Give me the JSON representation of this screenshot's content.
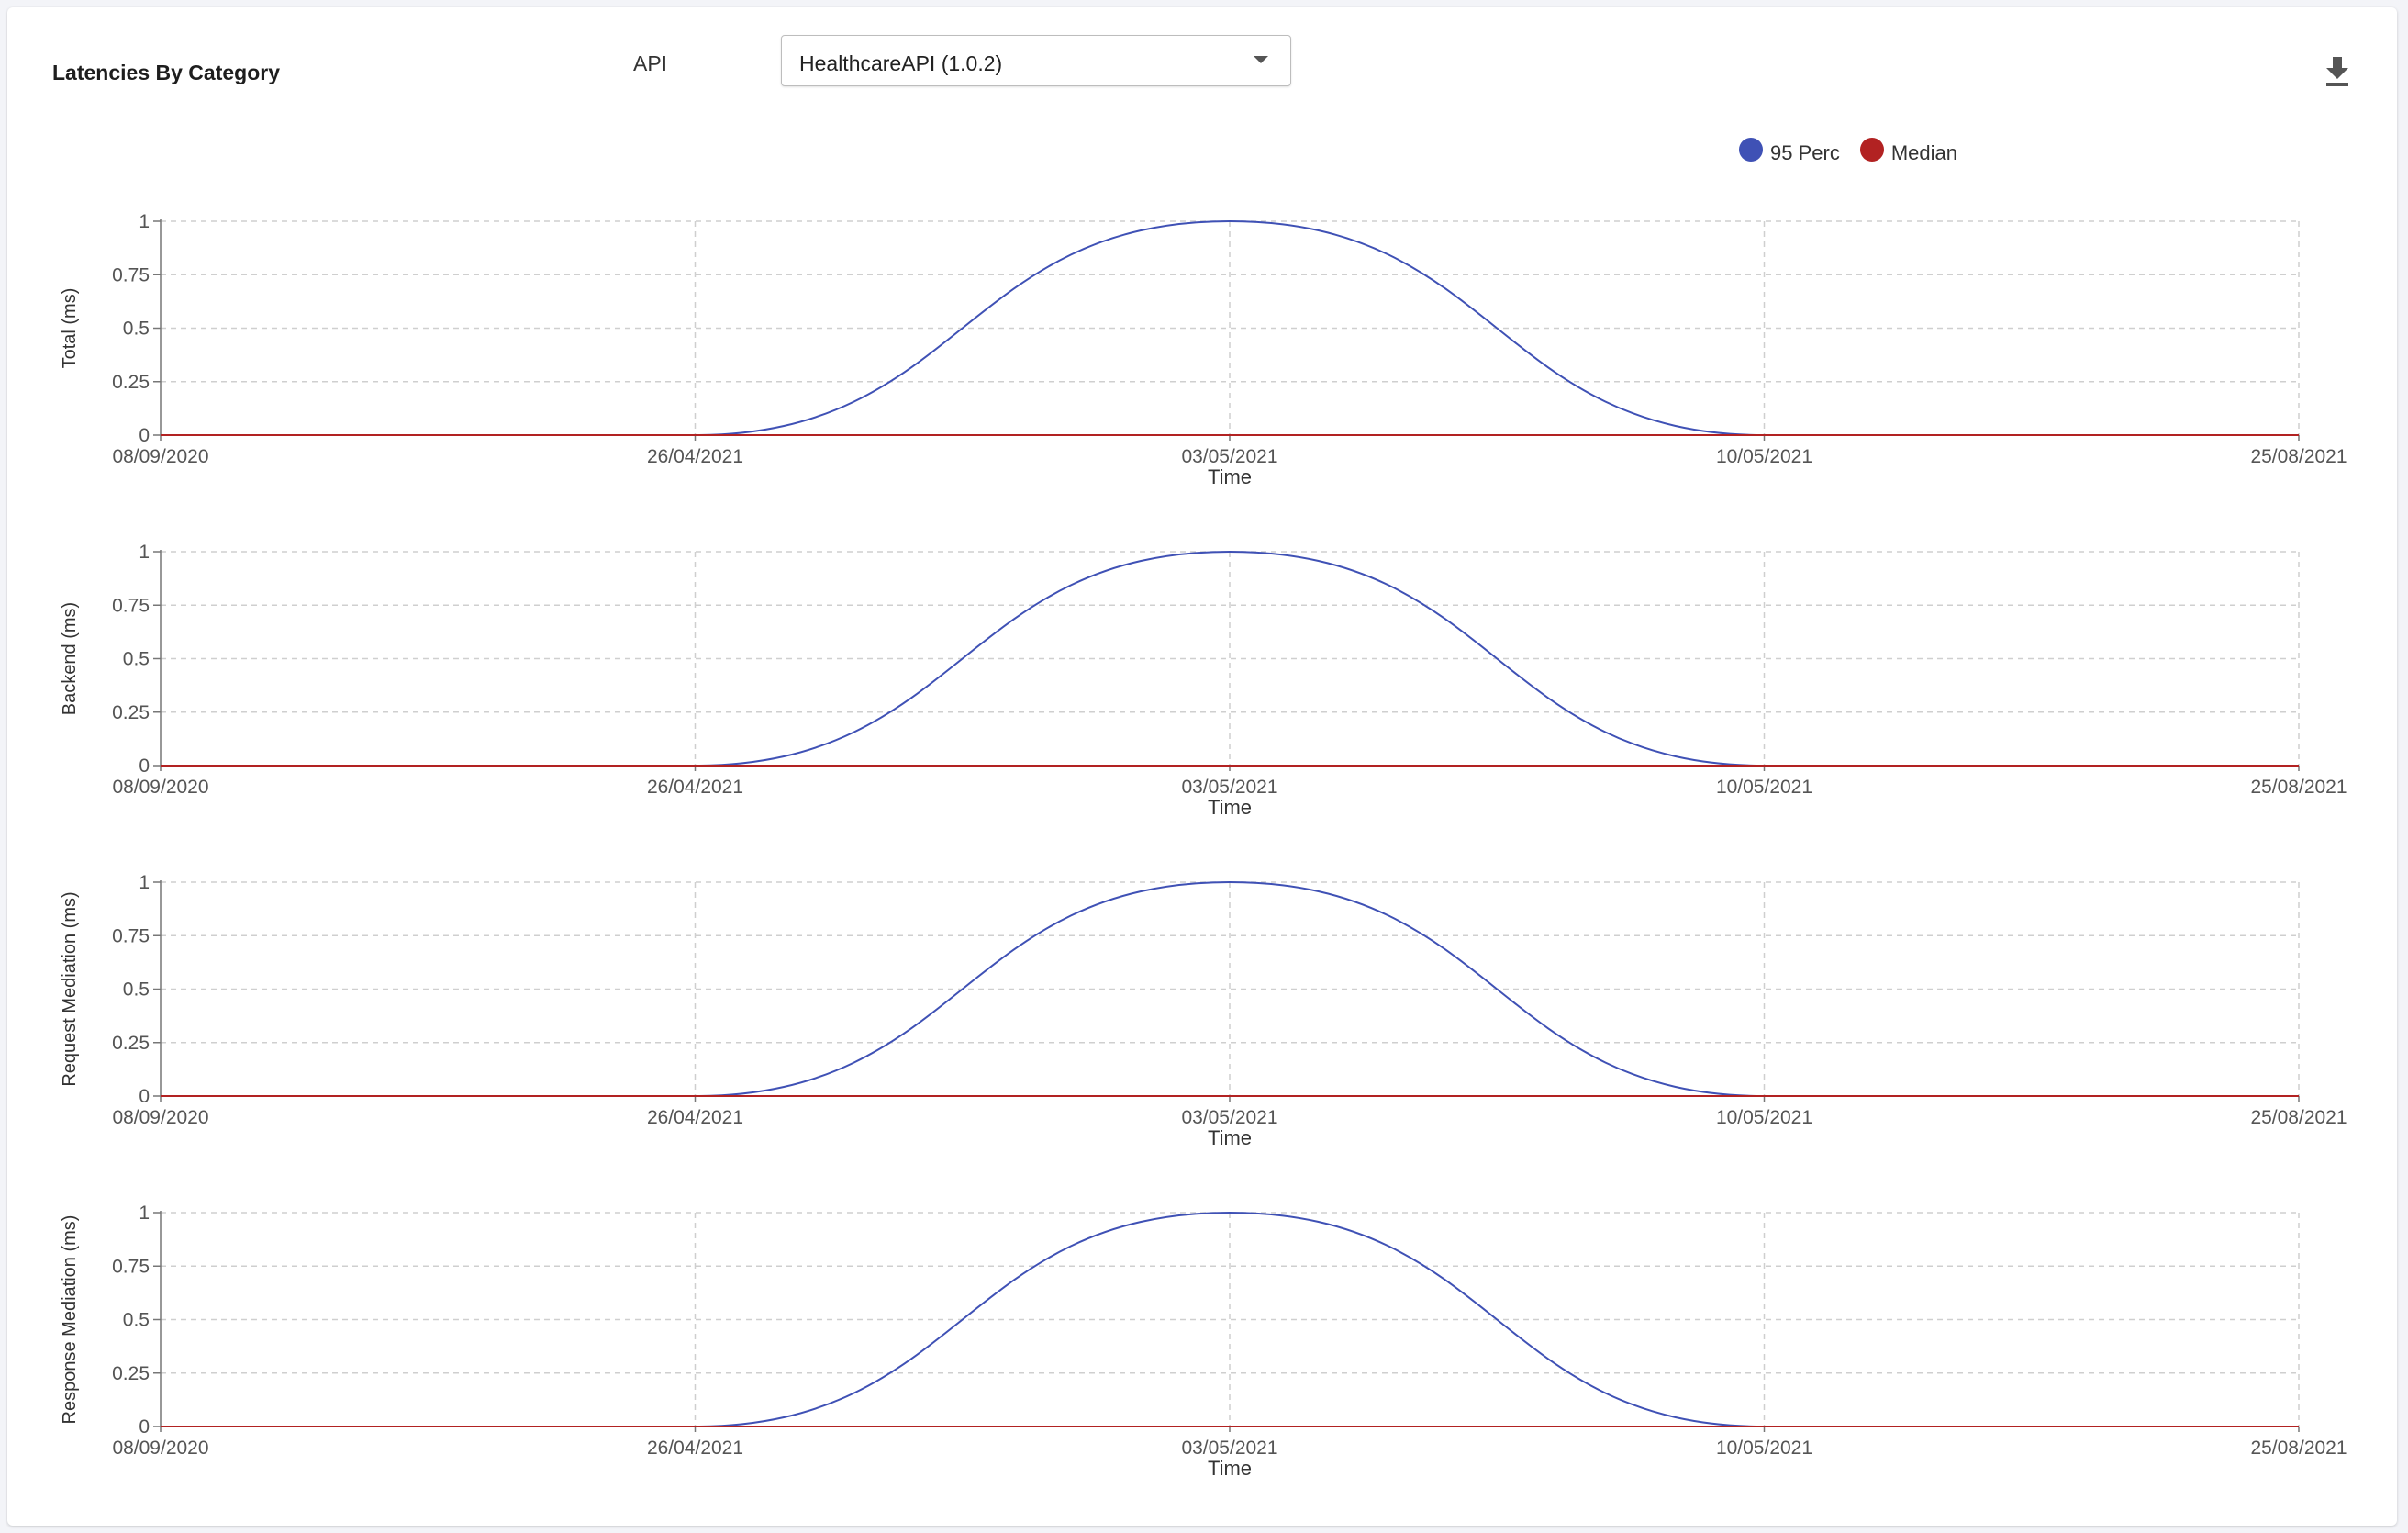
{
  "widget": {
    "title": "Latencies By Category",
    "api_label": "API",
    "api_selected": "HealthcareAPI (1.0.2)"
  },
  "legend": [
    {
      "name": "95 Perc",
      "color": "#3f51b5"
    },
    {
      "name": "Median",
      "color": "#b22222"
    }
  ],
  "icons": {
    "download": "download-icon",
    "dropdown": "caret-down-icon"
  },
  "chart_data": [
    {
      "type": "line",
      "ylabel": "Total (ms)",
      "xlabel": "Time",
      "x_ticks": [
        "08/09/2020",
        "26/04/2021",
        "03/05/2021",
        "10/05/2021",
        "25/08/2021"
      ],
      "y_ticks": [
        "0",
        "0.25",
        "0.5",
        "0.75",
        "1"
      ],
      "ylim": [
        0,
        1
      ],
      "grid": true,
      "series": [
        {
          "name": "95 Perc",
          "color": "#3f51b5",
          "x": [
            "08/09/2020",
            "26/04/2021",
            "03/05/2021",
            "10/05/2021",
            "25/08/2021"
          ],
          "values": [
            0,
            0,
            1,
            0,
            0
          ]
        },
        {
          "name": "Median",
          "color": "#b22222",
          "x": [
            "08/09/2020",
            "26/04/2021",
            "03/05/2021",
            "10/05/2021",
            "25/08/2021"
          ],
          "values": [
            0,
            0,
            0,
            0,
            0
          ]
        }
      ]
    },
    {
      "type": "line",
      "ylabel": "Backend (ms)",
      "xlabel": "Time",
      "x_ticks": [
        "08/09/2020",
        "26/04/2021",
        "03/05/2021",
        "10/05/2021",
        "25/08/2021"
      ],
      "y_ticks": [
        "0",
        "0.25",
        "0.5",
        "0.75",
        "1"
      ],
      "ylim": [
        0,
        1
      ],
      "grid": true,
      "series": [
        {
          "name": "95 Perc",
          "color": "#3f51b5",
          "x": [
            "08/09/2020",
            "26/04/2021",
            "03/05/2021",
            "10/05/2021",
            "25/08/2021"
          ],
          "values": [
            0,
            0,
            1,
            0,
            0
          ]
        },
        {
          "name": "Median",
          "color": "#b22222",
          "x": [
            "08/09/2020",
            "26/04/2021",
            "03/05/2021",
            "10/05/2021",
            "25/08/2021"
          ],
          "values": [
            0,
            0,
            0,
            0,
            0
          ]
        }
      ]
    },
    {
      "type": "line",
      "ylabel": "Request Mediation (ms)",
      "xlabel": "Time",
      "x_ticks": [
        "08/09/2020",
        "26/04/2021",
        "03/05/2021",
        "10/05/2021",
        "25/08/2021"
      ],
      "y_ticks": [
        "0",
        "0.25",
        "0.5",
        "0.75",
        "1"
      ],
      "ylim": [
        0,
        1
      ],
      "grid": true,
      "series": [
        {
          "name": "95 Perc",
          "color": "#3f51b5",
          "x": [
            "08/09/2020",
            "26/04/2021",
            "03/05/2021",
            "10/05/2021",
            "25/08/2021"
          ],
          "values": [
            0,
            0,
            1,
            0,
            0
          ]
        },
        {
          "name": "Median",
          "color": "#b22222",
          "x": [
            "08/09/2020",
            "26/04/2021",
            "03/05/2021",
            "10/05/2021",
            "25/08/2021"
          ],
          "values": [
            0,
            0,
            0,
            0,
            0
          ]
        }
      ]
    },
    {
      "type": "line",
      "ylabel": "Response Mediation (ms)",
      "xlabel": "Time",
      "x_ticks": [
        "08/09/2020",
        "26/04/2021",
        "03/05/2021",
        "10/05/2021",
        "25/08/2021"
      ],
      "y_ticks": [
        "0",
        "0.25",
        "0.5",
        "0.75",
        "1"
      ],
      "ylim": [
        0,
        1
      ],
      "grid": true,
      "series": [
        {
          "name": "95 Perc",
          "color": "#3f51b5",
          "x": [
            "08/09/2020",
            "26/04/2021",
            "03/05/2021",
            "10/05/2021",
            "25/08/2021"
          ],
          "values": [
            0,
            0,
            1,
            0,
            0
          ]
        },
        {
          "name": "Median",
          "color": "#b22222",
          "x": [
            "08/09/2020",
            "26/04/2021",
            "03/05/2021",
            "10/05/2021",
            "25/08/2021"
          ],
          "values": [
            0,
            0,
            0,
            0,
            0
          ]
        }
      ]
    }
  ]
}
